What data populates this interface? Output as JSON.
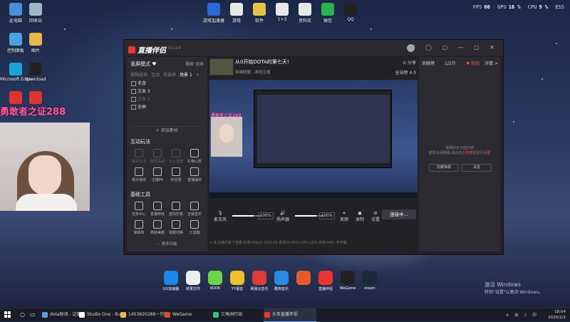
{
  "desktop": {
    "icons_left": [
      {
        "label": "此电脑",
        "color": "#4a90d9"
      },
      {
        "label": "回收站",
        "color": "#9fb6c8"
      },
      {
        "label": "控制面板",
        "color": "#4aa0e0"
      },
      {
        "label": "图片",
        "color": "#e8b84a"
      },
      {
        "label": "Microsoft Edge",
        "color": "#1aa3d8"
      },
      {
        "label": "download",
        "color": "#222222"
      },
      {
        "label": "",
        "color": "#d33"
      },
      {
        "label": "",
        "color": "#d33"
      }
    ],
    "icons_top": [
      {
        "label": "游戏加速器",
        "color": "#2a6ad8"
      },
      {
        "label": "游戏",
        "color": "#e8e8e8"
      },
      {
        "label": "软件",
        "color": "#e8c24a"
      },
      {
        "label": "1+3",
        "color": "#e8e8e8"
      },
      {
        "label": "资料库",
        "color": "#e8e8e8"
      },
      {
        "label": "微信",
        "color": "#29b34a"
      },
      {
        "label": "QQ",
        "color": "#222"
      }
    ],
    "perf": {
      "fps_label": "FPS",
      "fps": "60",
      "gpu_label": "GPU",
      "gpu": "16 %",
      "cpu_label": "CPU",
      "cpu": "9 %",
      "extra": "ESS"
    },
    "overlay_text": "勇敢者之证288",
    "dock": [
      {
        "label": "UU加速器",
        "color": "#1a88e8"
      },
      {
        "label": "效果文件",
        "color": "#eeeeee"
      },
      {
        "label": "KOOK",
        "color": "#6ad44a"
      },
      {
        "label": "YY语音",
        "color": "#f0c02a"
      },
      {
        "label": "网易云音乐",
        "color": "#e03a3a"
      },
      {
        "label": "酷狗音乐",
        "color": "#2a8ae8"
      },
      {
        "label": "",
        "color": "#e85a2a"
      },
      {
        "label": "直播伴侣",
        "color": "#e33"
      },
      {
        "label": "WeGame",
        "color": "#222"
      },
      {
        "label": "steam",
        "color": "#1b2838"
      }
    ],
    "activate_title": "激活 Windows",
    "activate_sub": "转到\"设置\"以激活 Windows。"
  },
  "app": {
    "name": "直播伴侣",
    "version": "9.5.3.4",
    "window_controls": "☐ ◯ ▢ — ▢ ✕",
    "left": {
      "mode": "竖屏模式 ♥",
      "mode_right": "横屏  竖屏",
      "tabs": [
        "视频选项",
        "互动",
        "可选项",
        "场景 1",
        "+"
      ],
      "sources": [
        {
          "label": "手游",
          "dim": false
        },
        {
          "label": "文本 3",
          "dim": false
        },
        {
          "label": "文本 2",
          "dim": true
        },
        {
          "label": "全屏",
          "dim": false
        }
      ],
      "add_source": "+ 添加素材",
      "interactive_title": "互动玩法",
      "interactive": [
        {
          "label": "投票玩法",
          "dim": true
        },
        {
          "label": "模型挑战",
          "dim": true
        },
        {
          "label": "多人连麦",
          "dim": true
        },
        {
          "label": "礼物心愿",
          "dim": false
        },
        {
          "label": "观众连线",
          "dim": false
        },
        {
          "label": "主播PK",
          "dim": false
        },
        {
          "label": "粉丝团",
          "dim": false
        },
        {
          "label": "直播抽奖",
          "dim": false
        }
      ],
      "tools_title": "基础工具",
      "tools": [
        {
          "label": "任务中心",
          "dim": false
        },
        {
          "label": "直播特效",
          "dim": false
        },
        {
          "label": "虚拟形象",
          "dim": false
        },
        {
          "label": "正版音乐",
          "dim": false
        },
        {
          "label": "弹幕库",
          "dim": false
        },
        {
          "label": "高级美颜",
          "dim": false
        },
        {
          "label": "场景切换",
          "dim": false
        },
        {
          "label": "工具箱",
          "dim": false
        }
      ],
      "more": "⋯ 更多功能"
    },
    "center": {
      "title": "从0开始DOTA的第七天!",
      "subtitle": "英雄联盟 · 游戏主播",
      "hdr_right": "⊙ 分享",
      "hdr_right2": "全站榜  4  0",
      "preview_overlay": "勇敢者之证288",
      "mic_label": "麦克风",
      "mic_pct": "100%",
      "speaker_label": "扬声器",
      "speaker_pct": "100%",
      "mic_level": 0.75,
      "speaker_level": 0.75,
      "btns": [
        "美颜",
        "录制",
        "设置"
      ],
      "live_btn": "连接中...",
      "status": "⊙ 此主播开启了直播   码率(0kb/s)   15/0.00   丢帧(0.00%)   CPU:10%   内存:54%   未开播"
    },
    "right": {
      "tab1": "贡献榜",
      "tab2": "1/2万",
      "tab3": "♥ 粉团",
      "tab4": "详情 >",
      "empty_line1": "弹幕助手已经开启",
      "empty_line2": "若想关闭弹幕,请点击",
      "empty_red1": "右侧按钮",
      "empty_line3": "进行",
      "empty_red2": "设置",
      "btn1": "隐藏弹幕",
      "btn2": "设置"
    }
  },
  "taskbar": {
    "items": [
      {
        "label": "dota助词 - 记事本",
        "color": "#5aa0e0",
        "active": false
      },
      {
        "label": "Studio One - Buc...",
        "color": "#ffffff",
        "active": false
      },
      {
        "label": "1453620288一只解...",
        "color": "#e8b84a",
        "active": false
      },
      {
        "label": "WeGame",
        "color": "#e04a2a",
        "active": false
      },
      {
        "label": "三角洲行动",
        "color": "#3ac07a",
        "active": false
      },
      {
        "label": "头条直播伴侣",
        "color": "#e33",
        "active": true
      }
    ],
    "tray_icons": "∧ ⊞ ♪ 中",
    "time": "18:04",
    "date": "2026/2/2"
  }
}
